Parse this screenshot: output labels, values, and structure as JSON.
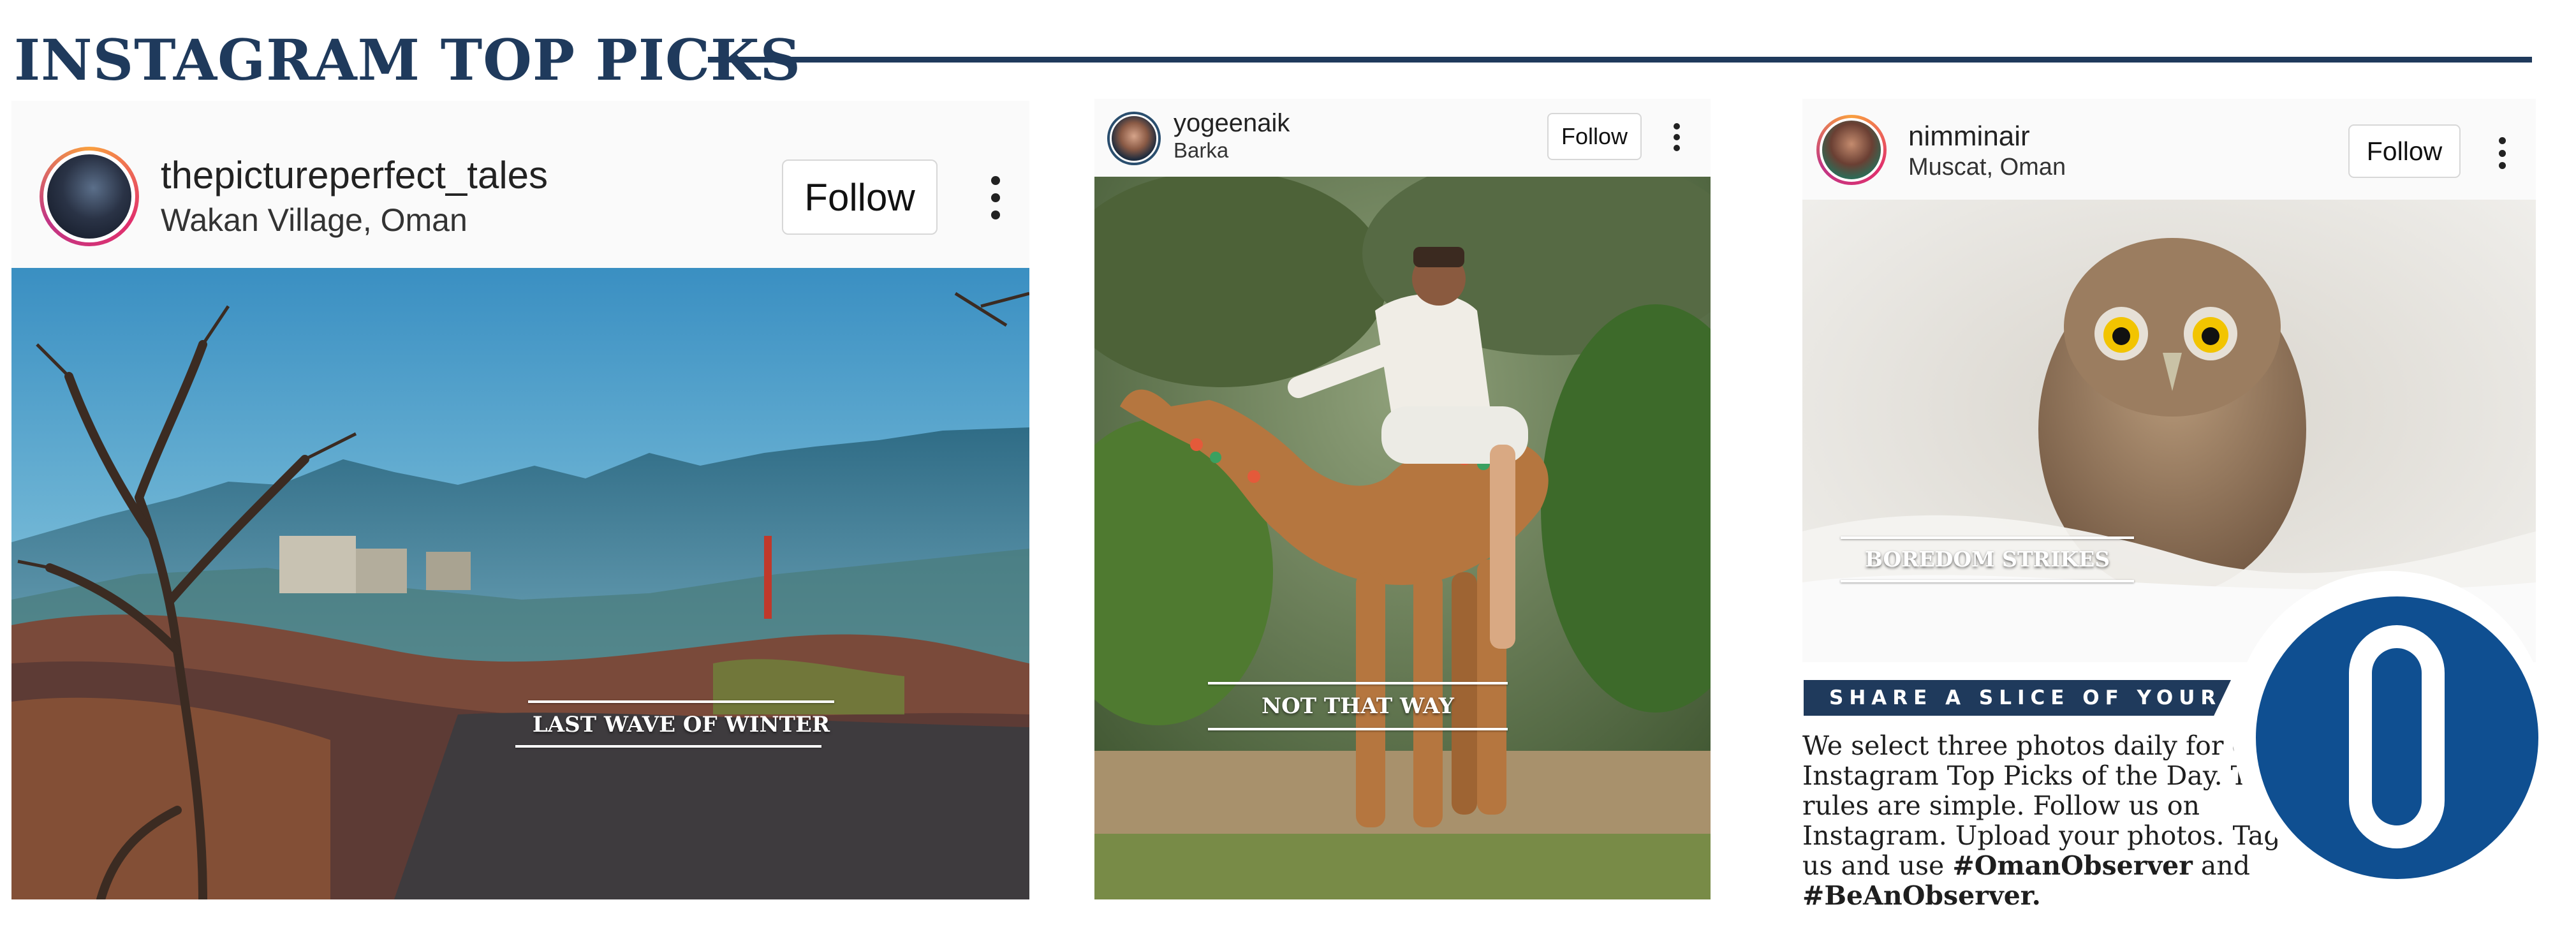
{
  "headline": "INSTAGRAM TOP PICKS",
  "posts": [
    {
      "username": "thepictureperfect_tales",
      "location": "Wakan Village, Oman",
      "follow_label": "Follow",
      "caption": "LAST WAVE OF WINTER",
      "photo_subject": "mountain village landscape with bare trees"
    },
    {
      "username": "yogeenaik",
      "location": "Barka",
      "follow_label": "Follow",
      "caption": "NOT THAT WAY",
      "photo_subject": "man riding a decorated camel"
    },
    {
      "username": "nimminair",
      "location": "Muscat, Oman",
      "follow_label": "Follow",
      "caption": "BOREDOM STRIKES",
      "photo_subject": "little owl in mist"
    }
  ],
  "promo": {
    "banner": "SHARE A SLICE OF YOUR LIFE",
    "text_1": "We select three photos daily for our Instagram Top Picks of the Day. The rules are simple. Follow us on Instagram. Upload your photos. Tag us and use ",
    "hashtag_1": "#OmanObserver",
    "text_and": " and ",
    "hashtag_2": "#BeAnObserver",
    "text_end": "."
  },
  "colors": {
    "navy": "#1f3a5c",
    "badge_blue": "#0f4f91"
  }
}
